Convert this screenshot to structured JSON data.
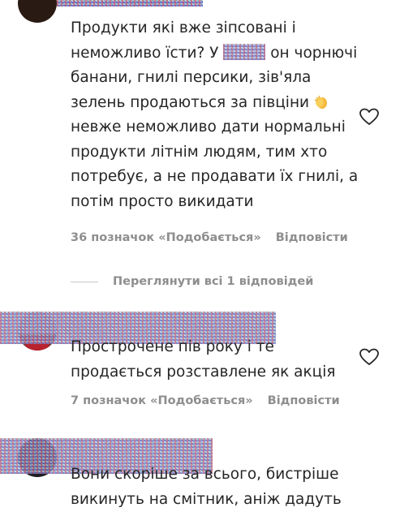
{
  "comments": [
    {
      "text_before": "Продукти які вже зіпсовані і неможливо їсти? У ",
      "text_after": " он чорнючі банани, гнилі персики, зів'яла зелень продаються за півціни ",
      "text_end": " невже неможливо дати нормальні продукти літнім людям, тим хто потребує, а не продавати їх гнилі, а потім просто викидати",
      "likes": "36 позначок «Подобається»",
      "reply": "Відповісти",
      "view_replies": "Переглянути всі 1 відповідей"
    },
    {
      "text": "Прострочене пів року і те продається розставлене як акція",
      "likes": "7 позначок «Подобається»",
      "reply": "Відповісти"
    },
    {
      "text": "Вони скоріше за всього, бистріше викинуть на смітник, аніж дадуть"
    }
  ],
  "colors": {
    "text": "#262626",
    "meta": "#8e8e8e",
    "heart_outline": "#262626"
  },
  "icons": [
    "heart-outline-icon",
    "clapping-hands-emoji"
  ]
}
